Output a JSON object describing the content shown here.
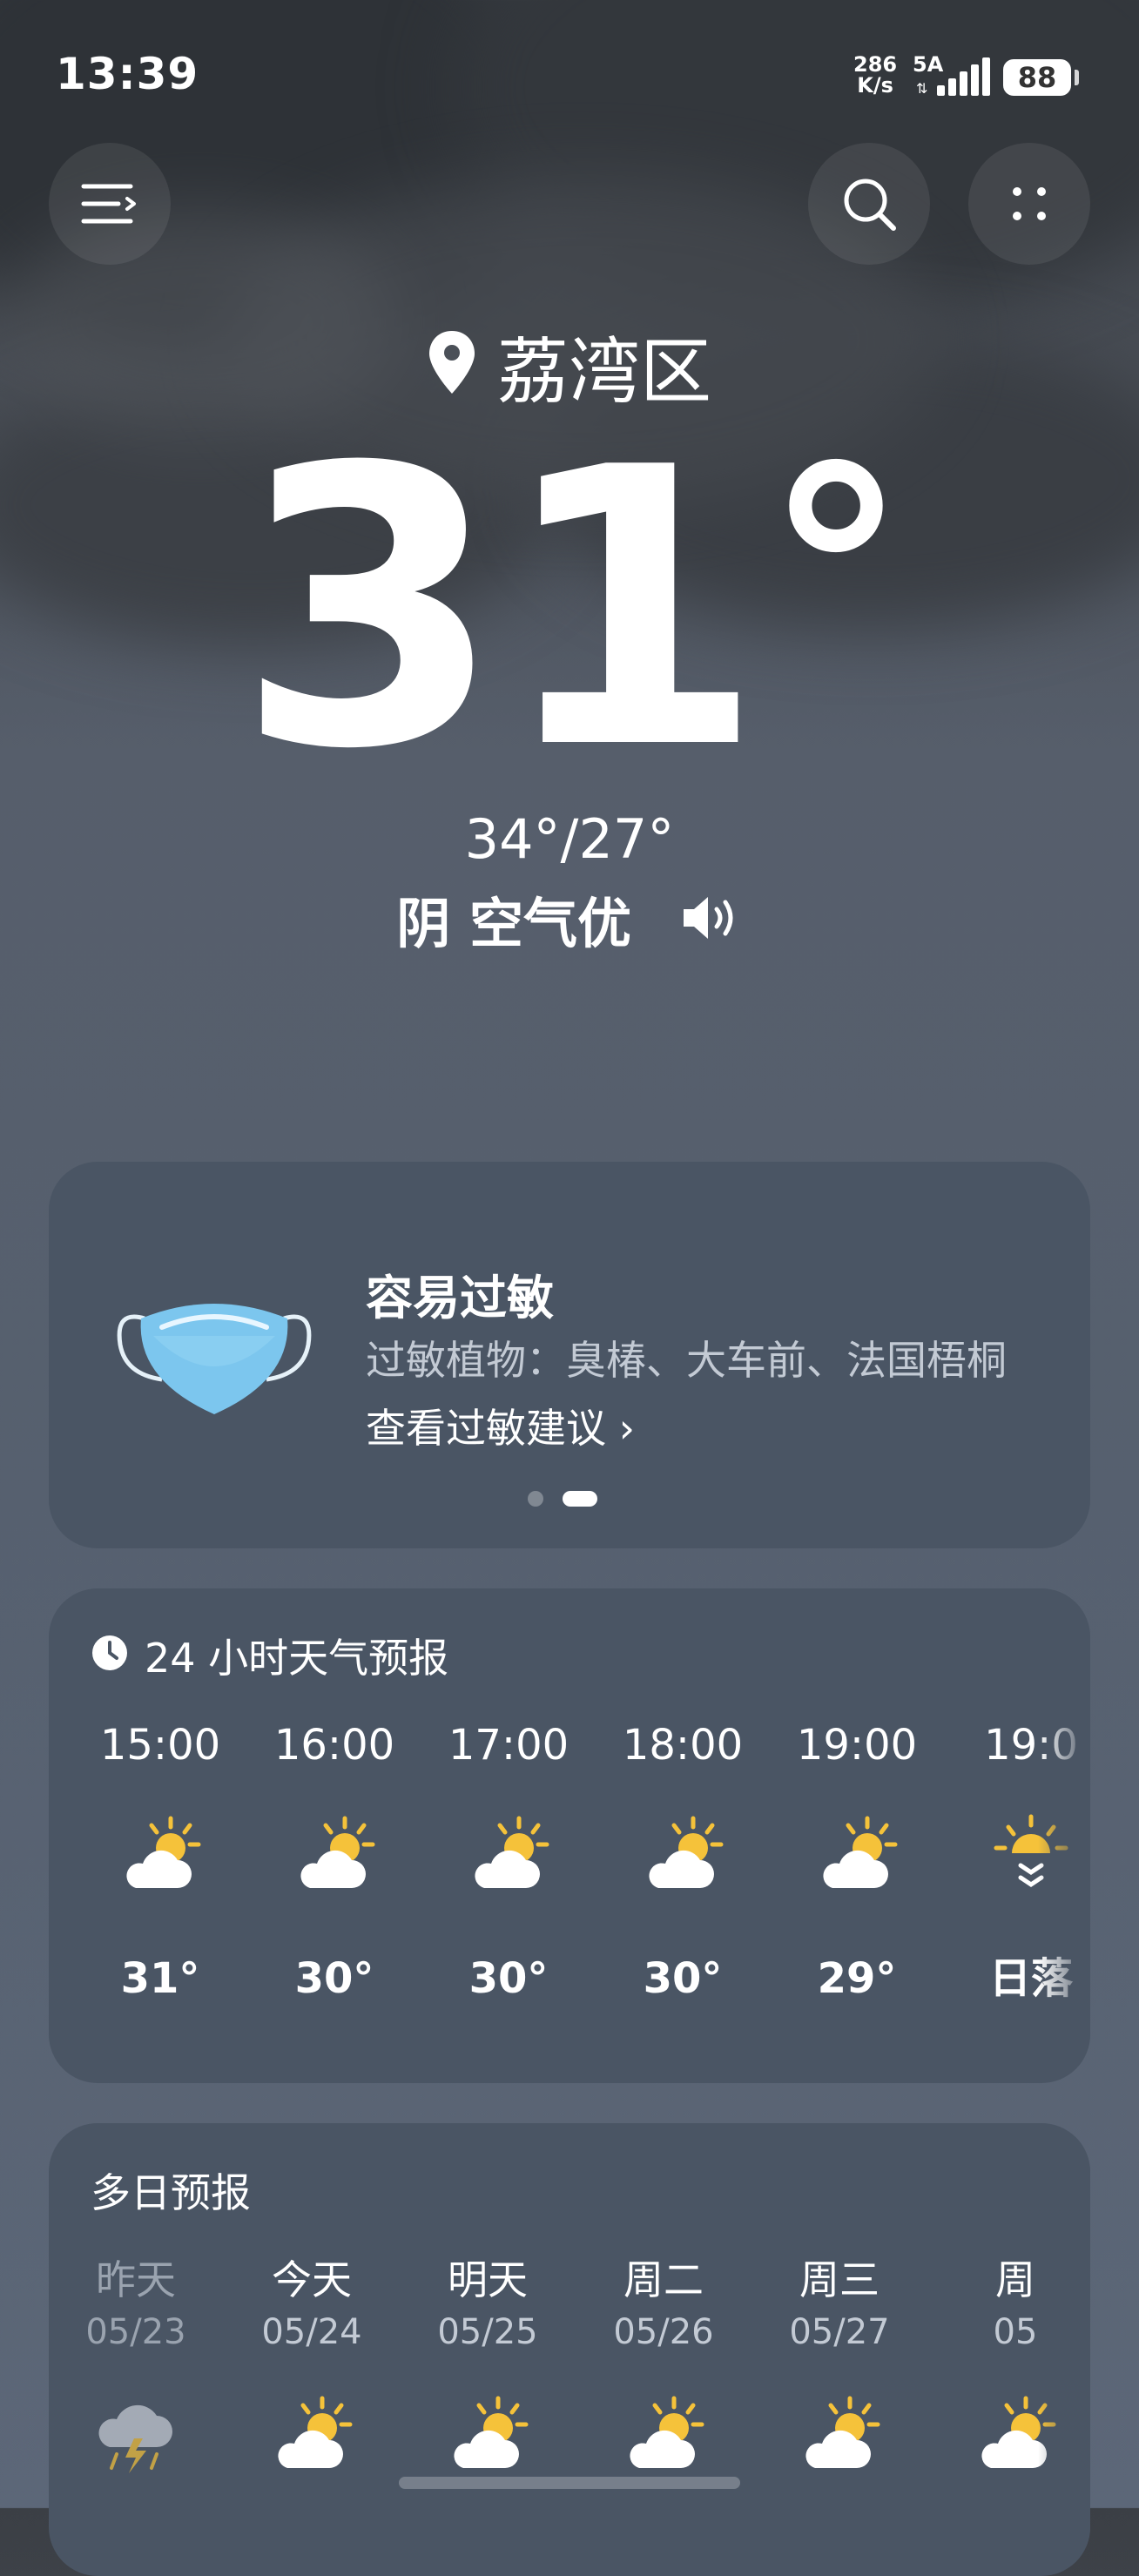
{
  "status_bar": {
    "time": "13:39",
    "net_speed_value": "286",
    "net_speed_unit": "K/s",
    "network_type": "5A",
    "battery": "88"
  },
  "top_bar": {
    "menu_icon": "menu-icon",
    "search_icon": "search-icon",
    "more_icon": "more-dots-icon"
  },
  "weather": {
    "location": "荔湾区",
    "temperature": "31",
    "degree_symbol": "°",
    "range": "34°/27°",
    "condition": "阴 空气优"
  },
  "allergy_card": {
    "title": "容易过敏",
    "description": "过敏植物：臭椿、大车前、法国梧桐",
    "link": "查看过敏建议 ›",
    "page_index": 2,
    "page_count": 2
  },
  "hourly_forecast": {
    "title": "24 小时天气预报",
    "hours": [
      {
        "time": "15:00",
        "icon": "partly-cloudy-day-icon",
        "temp": "31°"
      },
      {
        "time": "16:00",
        "icon": "partly-cloudy-day-icon",
        "temp": "30°"
      },
      {
        "time": "17:00",
        "icon": "partly-cloudy-day-icon",
        "temp": "30°"
      },
      {
        "time": "18:00",
        "icon": "partly-cloudy-day-icon",
        "temp": "30°"
      },
      {
        "time": "19:00",
        "icon": "partly-cloudy-day-icon",
        "temp": "29°"
      },
      {
        "time": "19:0",
        "icon": "sunset-icon",
        "temp": "日落"
      }
    ]
  },
  "daily_forecast": {
    "title": "多日预报",
    "days": [
      {
        "name": "昨天",
        "date": "05/23",
        "icon": "thunderstorm-icon"
      },
      {
        "name": "今天",
        "date": "05/24",
        "icon": "partly-cloudy-day-icon"
      },
      {
        "name": "明天",
        "date": "05/25",
        "icon": "partly-cloudy-day-icon"
      },
      {
        "name": "周二",
        "date": "05/26",
        "icon": "partly-cloudy-day-icon"
      },
      {
        "name": "周三",
        "date": "05/27",
        "icon": "partly-cloudy-day-icon"
      },
      {
        "name": "周",
        "date": "05",
        "icon": "partly-cloudy-day-icon"
      }
    ]
  },
  "colors": {
    "card_bg": "#4a5564",
    "sun": "#f5c23a",
    "cloud": "#ffffff",
    "mask": "#7cc6ee"
  }
}
